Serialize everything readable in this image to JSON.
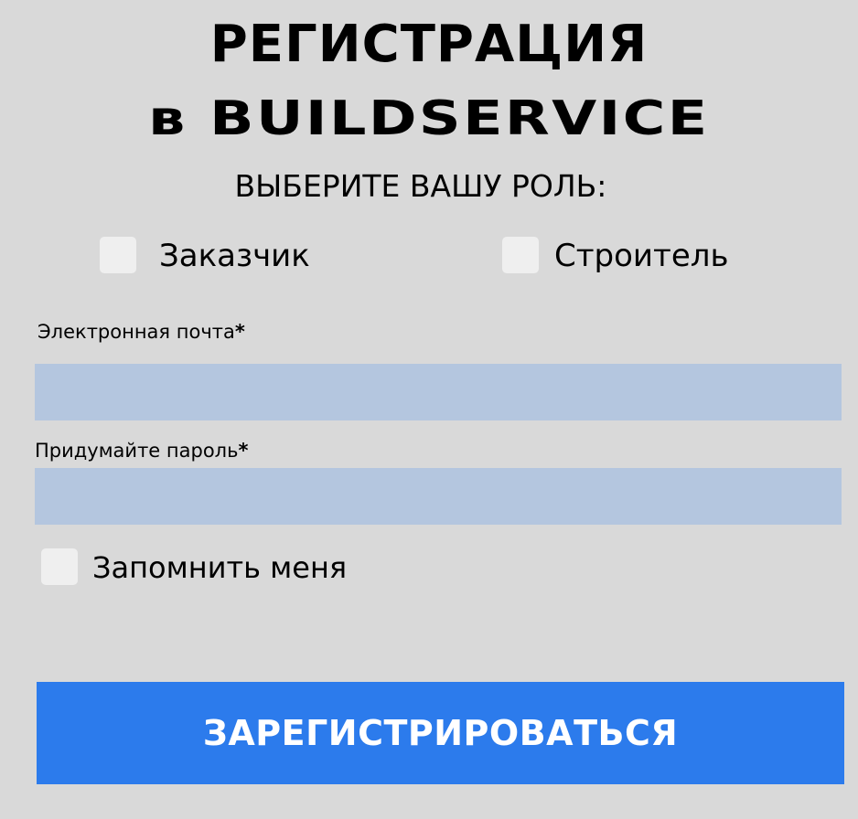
{
  "header": {
    "title_line1": "РЕГИСТРАЦИЯ",
    "title_line2": "в BUILDSERVICE",
    "subtitle": "ВЫБЕРИТЕ ВАШУ РОЛЬ:"
  },
  "roles": [
    {
      "label": "Заказчик",
      "checked": false
    },
    {
      "label": "Строитель",
      "checked": false
    }
  ],
  "form": {
    "email": {
      "label": "Электронная почта",
      "required_mark": "*",
      "value": ""
    },
    "password": {
      "label": "Придумайте пароль",
      "required_mark": "*",
      "value": ""
    },
    "remember": {
      "label": "Запомнить меня",
      "checked": false
    },
    "submit_label": "ЗАРЕГИСТРИРОВАТЬСЯ"
  },
  "colors": {
    "background": "#d9d9d9",
    "input_fill": "#b4c6df",
    "checkbox_fill": "#efefef",
    "primary_button": "#2c7bec",
    "button_text": "#ffffff"
  }
}
